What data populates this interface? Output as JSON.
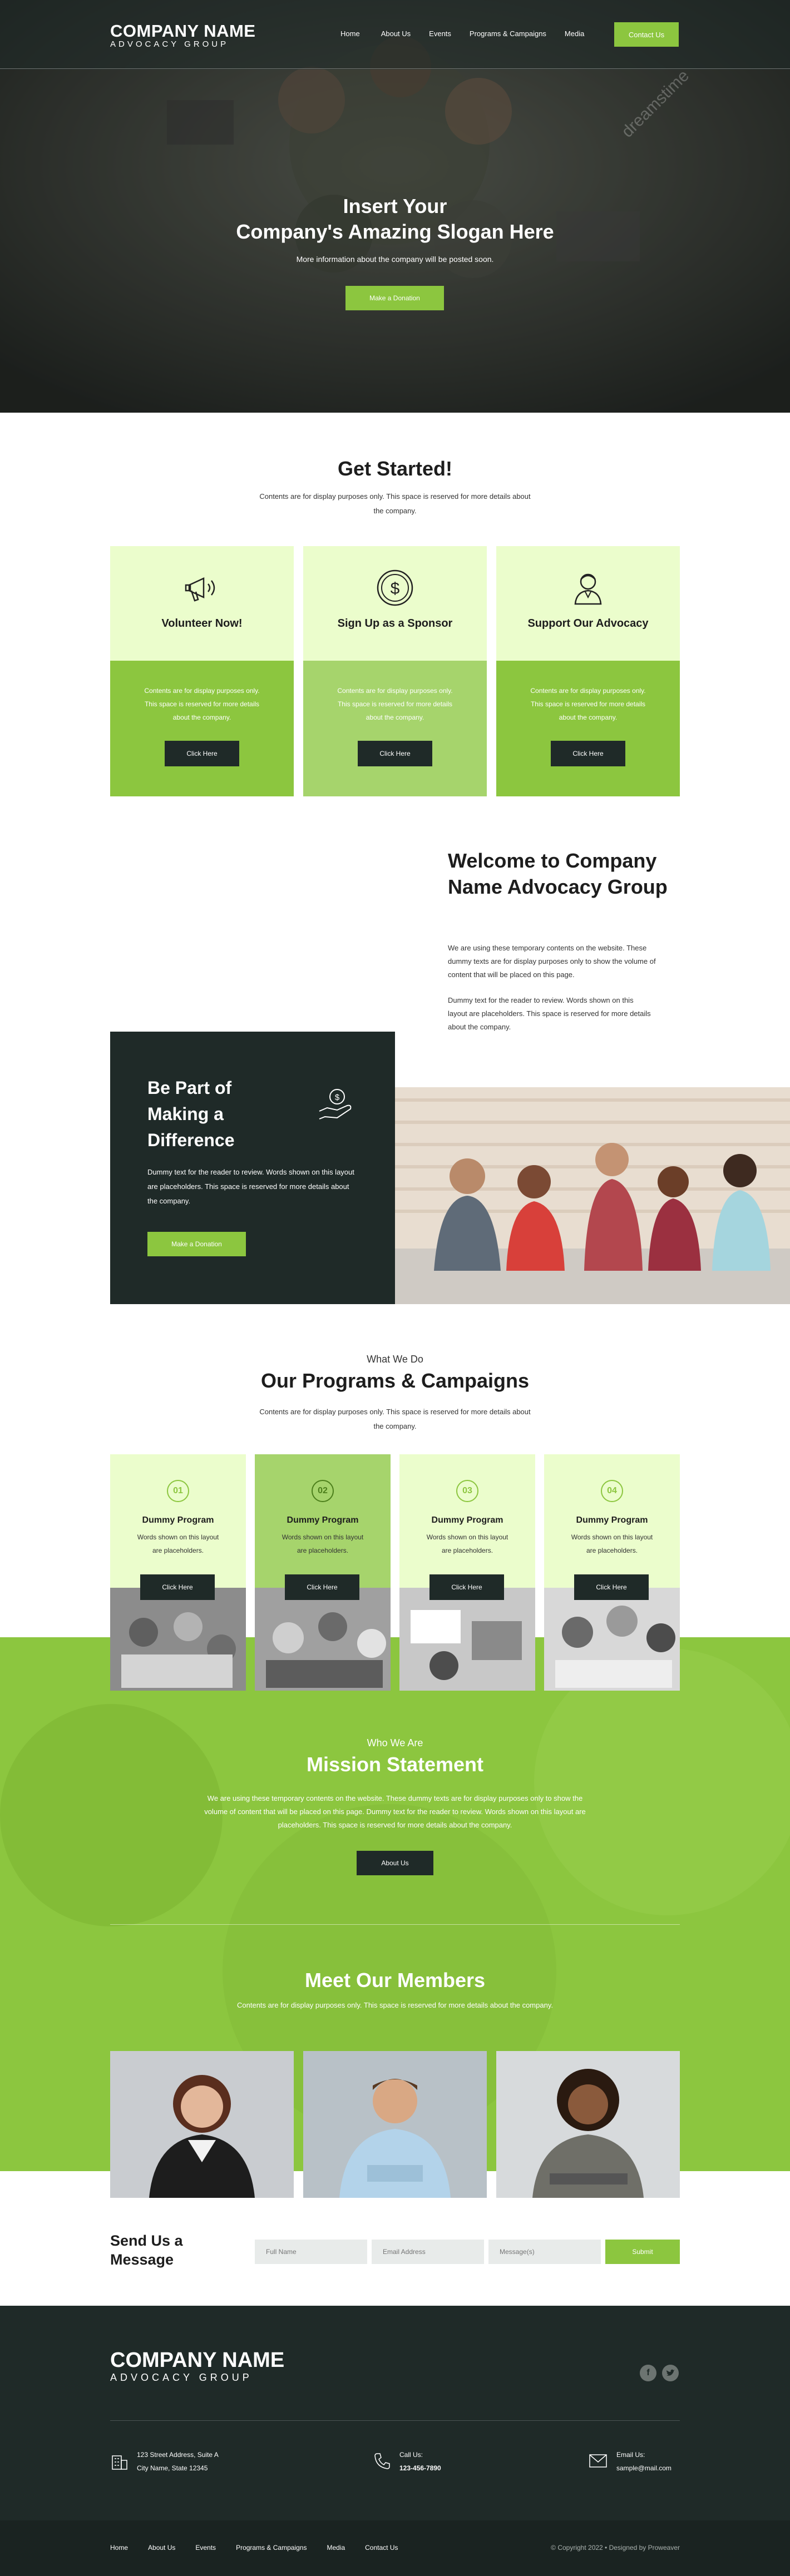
{
  "brand": {
    "name": "COMPANY NAME",
    "tagline": "ADVOCACY GROUP"
  },
  "nav": {
    "items": [
      "Home",
      "About Us",
      "Events",
      "Programs & Campaigns",
      "Media"
    ],
    "cta": "Contact Us"
  },
  "hero": {
    "title_line1": "Insert Your",
    "title_line2": "Company's Amazing Slogan Here",
    "subtitle": "More information about the company will be posted soon.",
    "button": "Make a Donation",
    "watermark": "dreamstime"
  },
  "get_started": {
    "title": "Get Started!",
    "text": "Contents are for display purposes only. This space is reserved for more details about the company.",
    "cards": [
      {
        "icon": "megaphone-icon",
        "title": "Volunteer Now!",
        "text": "Contents are for display purposes only. This space is reserved for more details about the company.",
        "button": "Click Here"
      },
      {
        "icon": "dollar-coin-icon",
        "title": "Sign Up as a Sponsor",
        "text": "Contents are for display purposes only. This space is reserved for more details about the company.",
        "button": "Click Here"
      },
      {
        "icon": "user-advocate-icon",
        "title": "Support Our Advocacy",
        "text": "Contents are for display purposes only. This space is reserved for more details about the company.",
        "button": "Click Here"
      }
    ]
  },
  "welcome": {
    "title": "Welcome to Company Name Advocacy Group",
    "p1": "We are using these temporary contents on the website. These dummy texts are for display purposes only to show the volume of content that will be placed on this page.",
    "p2": "Dummy text for the reader to review. Words shown on this layout are placeholders. This space is reserved for more details about the company."
  },
  "difference": {
    "title": "Be Part of Making a Difference",
    "text": "Dummy text for the reader to review. Words shown on this layout are placeholders. This space is reserved for more details about the company.",
    "button": "Make a Donation"
  },
  "programs": {
    "eyebrow": "What We Do",
    "title": "Our Programs & Campaigns",
    "text": "Contents are for display purposes only. This space is reserved for more details about the company.",
    "items": [
      {
        "num": "01",
        "title": "Dummy Program",
        "text": "Words shown on this layout are placeholders.",
        "button": "Click Here"
      },
      {
        "num": "02",
        "title": "Dummy Program",
        "text": "Words shown on this layout are placeholders.",
        "button": "Click Here"
      },
      {
        "num": "03",
        "title": "Dummy Program",
        "text": "Words shown on this layout are placeholders.",
        "button": "Click Here"
      },
      {
        "num": "04",
        "title": "Dummy Program",
        "text": "Words shown on this layout are placeholders.",
        "button": "Click Here"
      }
    ]
  },
  "mission": {
    "eyebrow": "Who We Are",
    "title": "Mission Statement",
    "text": "We are using these temporary contents on the website. These dummy texts are for display purposes only to show the volume of content that will be placed on this page. Dummy text for the reader to review. Words shown on this layout are placeholders. This space is reserved for more details about the company.",
    "button": "About Us"
  },
  "members": {
    "title": "Meet Our Members",
    "text": "Contents are for display purposes only. This space is reserved for more details about the company."
  },
  "contact_form": {
    "title": "Send Us a Message",
    "full_name": "Full Name",
    "email": "Email Address",
    "message": "Message(s)",
    "submit": "Submit"
  },
  "footer": {
    "address_line1": "123 Street Address, Suite A",
    "address_line2": "City Name, State 12345",
    "call_label": "Call Us:",
    "phone": "123-456-7890",
    "email_label": "Email Us:",
    "email": "sample@mail.com",
    "links": [
      "Home",
      "About Us",
      "Events",
      "Programs & Campaigns",
      "Media",
      "Contact Us"
    ],
    "copyright": "© Copyright 2022 • Designed by Proweaver"
  },
  "colors": {
    "accent": "#8cc63f",
    "light_green": "#ebfdcc",
    "dark": "#1f2a28"
  }
}
